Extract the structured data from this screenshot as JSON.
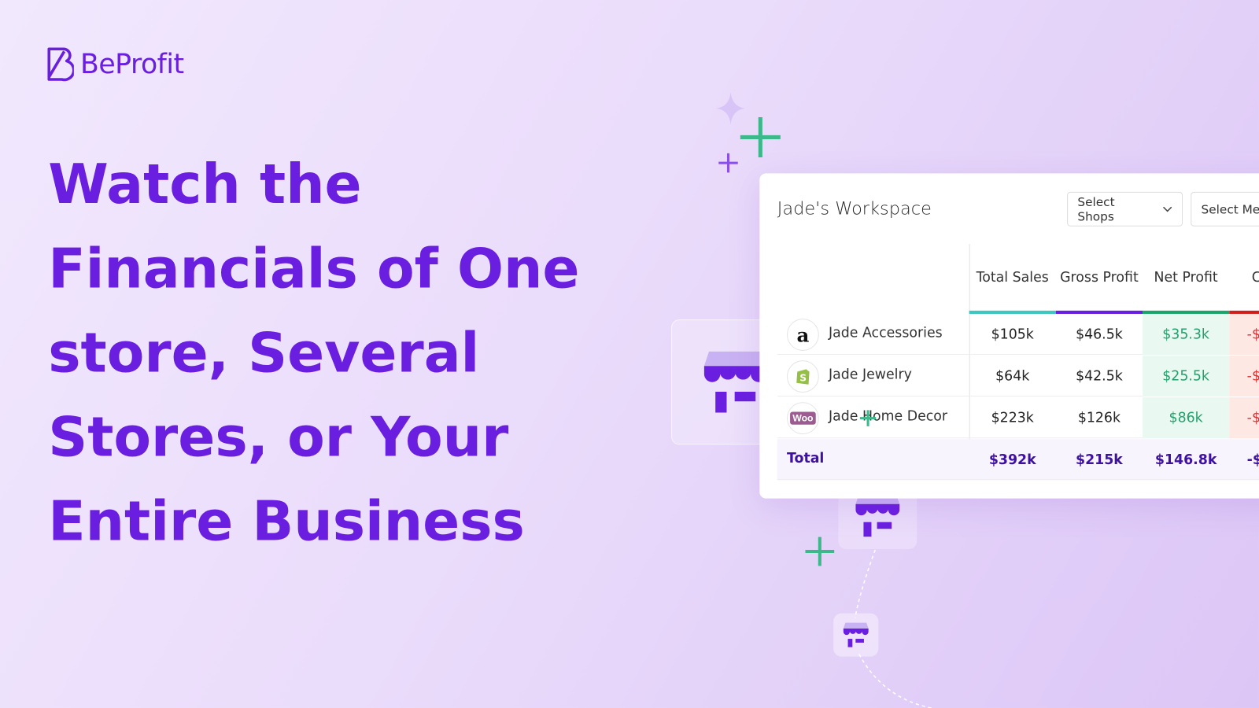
{
  "brand": {
    "name": "BeProfit",
    "color": "#6a1fe0"
  },
  "headline": [
    "Watch the",
    "Financials of One",
    "store, Several",
    "Stores, or Your",
    "Entire Business"
  ],
  "workspace": {
    "title": "Jade's Workspace",
    "select_shops": "Select Shops",
    "select_metrics": "Select Me",
    "columns": [
      {
        "label": "Total Sales",
        "color": "#3ec6c0"
      },
      {
        "label": "Gross Profit",
        "color": "#6a1fe0"
      },
      {
        "label": "Net Profit",
        "color": "#1aa56b"
      },
      {
        "label": "C",
        "color": "#d0201b"
      }
    ],
    "rows": [
      {
        "shop": "Jade Accessories",
        "icon": "amazon-icon",
        "values": [
          "$105k",
          "$46.5k",
          "$35.3k",
          "-$"
        ]
      },
      {
        "shop": "Jade Jewelry",
        "icon": "shopify-icon",
        "values": [
          "$64k",
          "$42.5k",
          "$25.5k",
          "-$"
        ]
      },
      {
        "shop": "Jade Home Decor",
        "icon": "woocommerce-icon",
        "values": [
          "$223k",
          "$126k",
          "$86k",
          "-$"
        ]
      }
    ],
    "total": {
      "label": "Total",
      "values": [
        "$392k",
        "$215k",
        "$146.8k",
        "-$"
      ]
    }
  }
}
